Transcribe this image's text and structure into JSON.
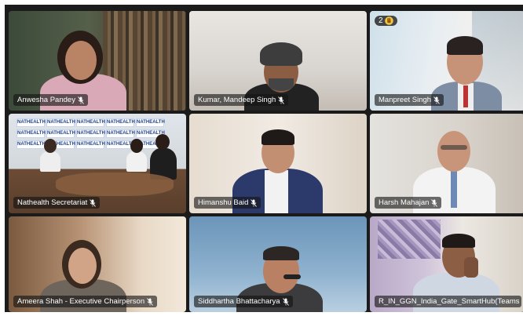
{
  "meeting": {
    "participants": [
      {
        "name": "Anwesha Pandey",
        "muted": true
      },
      {
        "name": "Kumar, Mandeep Singh",
        "muted": true
      },
      {
        "name": "Manpreet Singh",
        "muted": true,
        "raised_hand": true,
        "hand_count": "2"
      },
      {
        "name": "Nathealth Secretariat",
        "muted": true
      },
      {
        "name": "Himanshu Baid",
        "muted": true
      },
      {
        "name": "Harsh Mahajan",
        "muted": true
      },
      {
        "name": "Ameera Shah - Executive Chairperson",
        "muted": true
      },
      {
        "name": "Siddhartha Bhattacharya",
        "muted": true
      },
      {
        "name": "R_IN_GGN_India_Gate_SmartHub(Teams Vi...",
        "muted": false
      }
    ],
    "banner_text": "NATHEALTH",
    "accent_color": "#7b83eb"
  }
}
